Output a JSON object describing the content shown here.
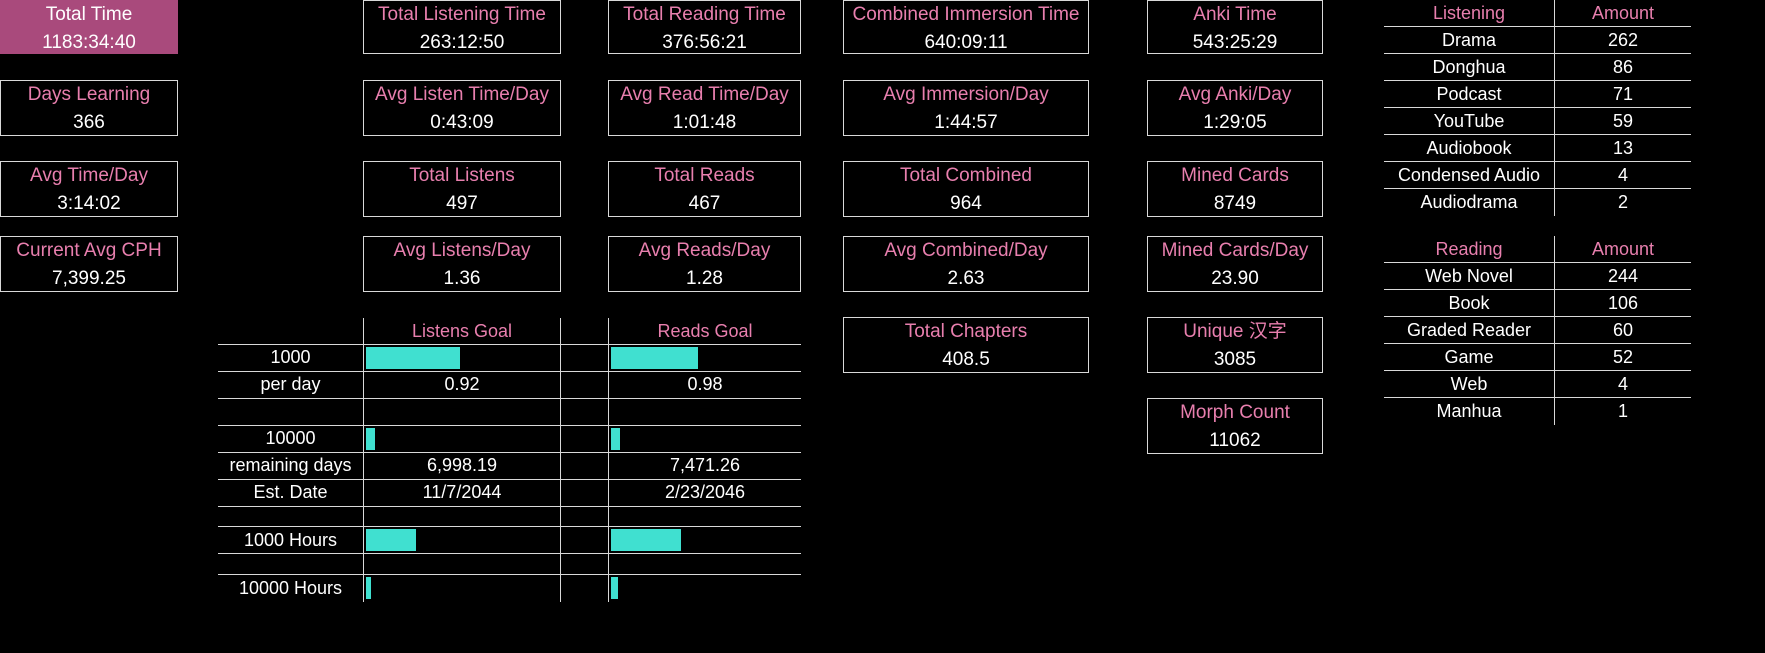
{
  "left": {
    "total_time": {
      "label": "Total Time",
      "value": "1183:34:40"
    },
    "days_learning": {
      "label": "Days Learning",
      "value": "366"
    },
    "avg_time_day": {
      "label": "Avg Time/Day",
      "value": "3:14:02"
    },
    "current_avg_cph": {
      "label": "Current Avg CPH",
      "value": "7,399.25"
    }
  },
  "listening": {
    "total": {
      "label": "Total Listening Time",
      "value": "263:12:50"
    },
    "avg_day": {
      "label": "Avg Listen Time/Day",
      "value": "0:43:09"
    },
    "count": {
      "label": "Total Listens",
      "value": "497"
    },
    "count_day": {
      "label": "Avg Listens/Day",
      "value": "1.36"
    }
  },
  "reading": {
    "total": {
      "label": "Total Reading Time",
      "value": "376:56:21"
    },
    "avg_day": {
      "label": "Avg Read Time/Day",
      "value": "1:01:48"
    },
    "count": {
      "label": "Total Reads",
      "value": "467"
    },
    "count_day": {
      "label": "Avg Reads/Day",
      "value": "1.28"
    }
  },
  "combined": {
    "total": {
      "label": "Combined Immersion Time",
      "value": "640:09:11"
    },
    "avg_day": {
      "label": "Avg Immersion/Day",
      "value": "1:44:57"
    },
    "count": {
      "label": "Total Combined",
      "value": "964"
    },
    "count_day": {
      "label": "Avg Combined/Day",
      "value": "2.63"
    },
    "chapters": {
      "label": "Total Chapters",
      "value": "408.5"
    }
  },
  "anki": {
    "total": {
      "label": "Anki Time",
      "value": "543:25:29"
    },
    "avg_day": {
      "label": "Avg Anki/Day",
      "value": "1:29:05"
    },
    "mined": {
      "label": "Mined Cards",
      "value": "8749"
    },
    "mined_day": {
      "label": "Mined Cards/Day",
      "value": "23.90"
    },
    "unique_hanzi": {
      "label": "Unique 汉字",
      "value": "3085"
    },
    "morph_count": {
      "label": "Morph Count",
      "value": "11062"
    }
  },
  "goals": {
    "headers": {
      "listens": "Listens Goal",
      "reads": "Reads Goal"
    },
    "rows": {
      "goal_1000": "1000",
      "per_day": "per day",
      "goal_10000": "10000",
      "remaining_days": "remaining days",
      "est_date": "Est. Date",
      "hours_1000": "1000 Hours",
      "hours_10000": "10000 Hours"
    },
    "listens": {
      "progress_1000": 0.497,
      "per_day": "0.92",
      "progress_10000": 0.0497,
      "remaining_days": "6,998.19",
      "est_date": "11/7/2044",
      "progress_1000_hours": 0.263,
      "progress_10000_hours": 0.0263
    },
    "reads": {
      "progress_1000": 0.467,
      "per_day": "0.98",
      "progress_10000": 0.0467,
      "remaining_days": "7,471.26",
      "est_date": "2/23/2046",
      "progress_1000_hours": 0.377,
      "progress_10000_hours": 0.0377
    },
    "bar_color": "#40e0d0"
  },
  "listening_table": {
    "headers": [
      "Listening",
      "Amount"
    ],
    "rows": [
      [
        "Drama",
        "262"
      ],
      [
        "Donghua",
        "86"
      ],
      [
        "Podcast",
        "71"
      ],
      [
        "YouTube",
        "59"
      ],
      [
        "Audiobook",
        "13"
      ],
      [
        "Condensed Audio",
        "4"
      ],
      [
        "Audiodrama",
        "2"
      ]
    ]
  },
  "reading_table": {
    "headers": [
      "Reading",
      "Amount"
    ],
    "rows": [
      [
        "Web Novel",
        "244"
      ],
      [
        "Book",
        "106"
      ],
      [
        "Graded Reader",
        "60"
      ],
      [
        "Game",
        "52"
      ],
      [
        "Web",
        "4"
      ],
      [
        "Manhua",
        "1"
      ]
    ]
  },
  "colors": {
    "background": "#000000",
    "label": "#e87fae",
    "highlight": "#a94a7c",
    "bar": "#40e0d0",
    "border": "#d9d9d9"
  }
}
